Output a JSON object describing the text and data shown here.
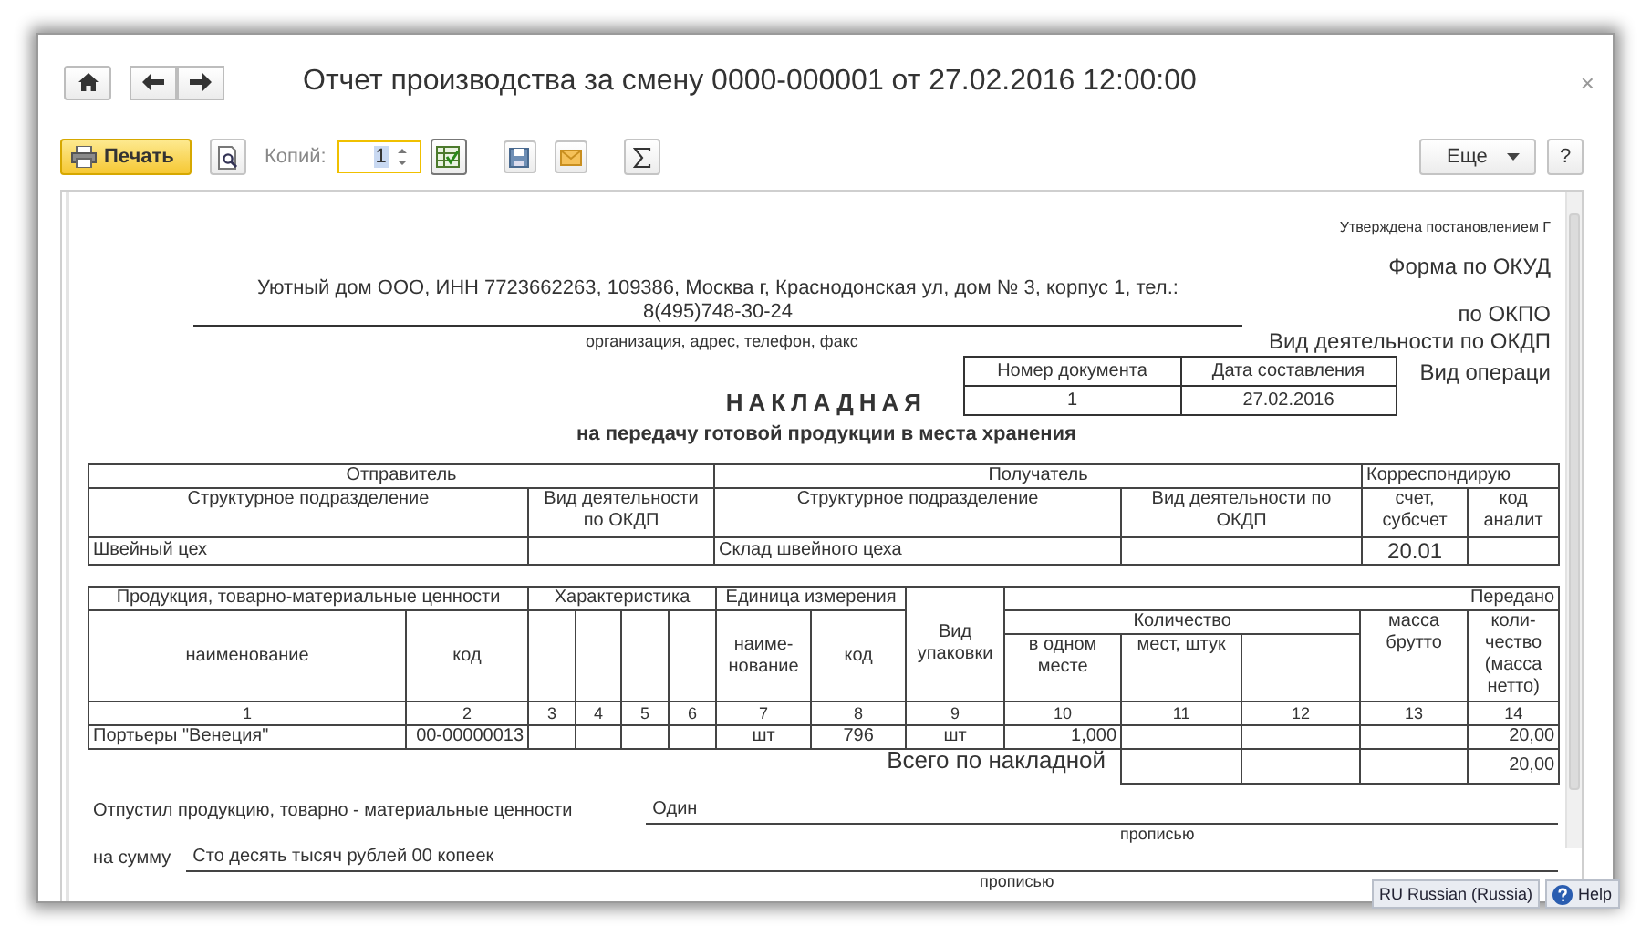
{
  "window": {
    "title": "Отчет производства за смену 0000-000001 от 27.02.2016 12:00:00",
    "close": "×"
  },
  "toolbar": {
    "print_button": "Печать",
    "copies_label": "Копий:",
    "copies_value": "1",
    "more_button": "Еще",
    "help_button": "?"
  },
  "document": {
    "approved_note": "Утверждена постановлением Г",
    "code_labels": [
      "Форма по ОКУД",
      "по ОКПО",
      "Вид деятельности по ОКДП",
      "Вид операци"
    ],
    "organization_lines": [
      "Уютный дом ООО, ИНН 7723662263, 109386, Москва г, Краснодонская ул, дом № 3, корпус 1, тел.:",
      "8(495)748-30-24"
    ],
    "organization_caption": "организация, адрес, телефон, факс",
    "title": "НАКЛАДНАЯ",
    "subtitle": "на передачу готовой продукции в места хранения",
    "doc_number": {
      "headers": [
        "Номер документа",
        "Дата составления"
      ],
      "values": [
        "1",
        "27.02.2016"
      ]
    },
    "parties_table": {
      "groups": [
        "Отправитель",
        "Получатель",
        "Корреспондирую"
      ],
      "columns": [
        "Структурное подразделение",
        "Вид деятельности по ОКДП",
        "Структурное подразделение",
        "Вид деятельности по ОКДП",
        "счет, субсчет",
        "код аналит"
      ],
      "row": {
        "sender_unit": "Швейный цех",
        "receiver_unit": "Склад швейного цеха",
        "account": "20.01"
      }
    },
    "goods_table": {
      "group_headers": {
        "products": "Продукция, товарно-материальные ценности",
        "characteristic": "Характеристика",
        "unit": "Единица измерения",
        "package": "Вид упаковки",
        "transferred": "Передано",
        "quantity": "Количество"
      },
      "column_headers": {
        "name": "наименование",
        "code": "код",
        "unit_name": "наиме-нование",
        "unit_code": "код",
        "per_place": "в одном месте",
        "places": "мест, штук",
        "gross": "масса брутто",
        "net": "коли-чество (масса нетто)"
      },
      "column_numbers": [
        "1",
        "2",
        "3",
        "4",
        "5",
        "6",
        "7",
        "8",
        "9",
        "10",
        "11",
        "12",
        "13",
        "14"
      ],
      "row": {
        "name": "Портьеры \"Венеция\"",
        "code": "00-00000013",
        "unit_name": "шт",
        "unit_code": "796",
        "package": "шт",
        "per_place": "1,000",
        "net": "20,00"
      },
      "total": {
        "label": "Всего по накладной",
        "net": "20,00"
      }
    },
    "released": {
      "label": "Отпустил продукцию, товарно - материальные ценности",
      "value": "Один",
      "caption": "прописью"
    },
    "sum": {
      "label": "на сумму",
      "value": "Сто десять тысяч рублей 00 копеек",
      "caption": "прописью"
    }
  },
  "taskbar": {
    "language": "RU Russian (Russia)",
    "help": "Help"
  }
}
